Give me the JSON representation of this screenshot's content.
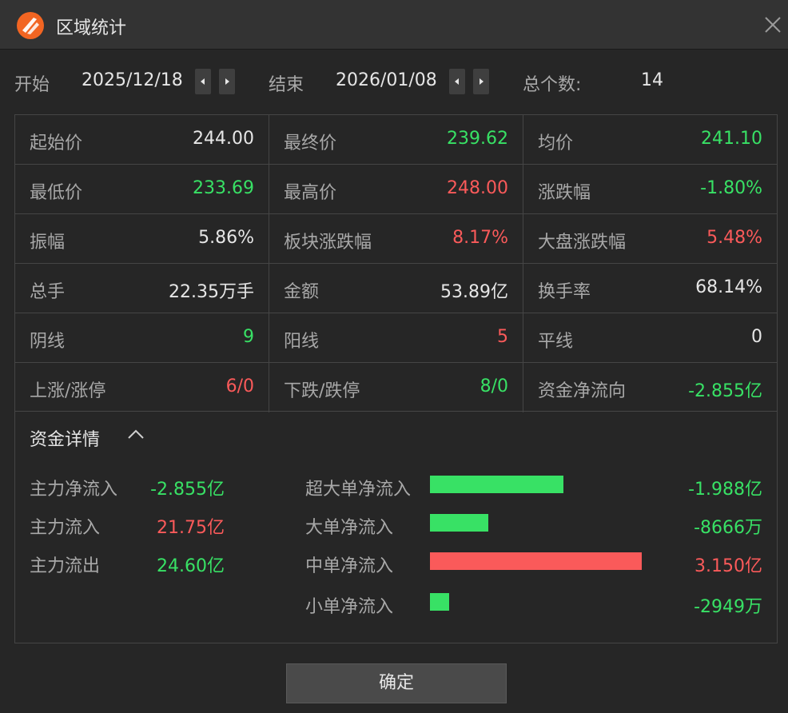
{
  "window": {
    "title": "区域统计"
  },
  "range": {
    "start_label": "开始",
    "start_value": "2025/12/18",
    "end_label": "结束",
    "end_value": "2026/01/08",
    "count_label": "总个数:",
    "count_value": "14"
  },
  "stats": [
    [
      {
        "k": "起始价",
        "v": "244.00",
        "c": "white"
      },
      {
        "k": "最终价",
        "v": "239.62",
        "c": "green"
      },
      {
        "k": "均价",
        "v": "241.10",
        "c": "green"
      }
    ],
    [
      {
        "k": "最低价",
        "v": "233.69",
        "c": "green"
      },
      {
        "k": "最高价",
        "v": "248.00",
        "c": "red"
      },
      {
        "k": "涨跌幅",
        "v": "-1.80%",
        "c": "green"
      }
    ],
    [
      {
        "k": "振幅",
        "v": "5.86%",
        "c": "white"
      },
      {
        "k": "板块涨跌幅",
        "v": "8.17%",
        "c": "red"
      },
      {
        "k": "大盘涨跌幅",
        "v": "5.48%",
        "c": "red"
      }
    ],
    [
      {
        "k": "总手",
        "v": "22.35万手",
        "c": "white"
      },
      {
        "k": "金额",
        "v": "53.89亿",
        "c": "white"
      },
      {
        "k": "换手率",
        "v": "68.14%",
        "c": "white"
      }
    ],
    [
      {
        "k": "阴线",
        "v": "9",
        "c": "green"
      },
      {
        "k": "阳线",
        "v": "5",
        "c": "red"
      },
      {
        "k": "平线",
        "v": "0",
        "c": "white"
      }
    ],
    [
      {
        "k": "上涨/涨停",
        "v": "6/0",
        "c": "red"
      },
      {
        "k": "下跌/跌停",
        "v": "8/0",
        "c": "green"
      },
      {
        "k": "资金净流向",
        "v": "-2.855亿",
        "c": "green"
      }
    ]
  ],
  "fund": {
    "title": "资金详情",
    "main": [
      {
        "k": "主力净流入",
        "v": "-2.855亿",
        "c": "green"
      },
      {
        "k": "主力流入",
        "v": "21.75亿",
        "c": "red"
      },
      {
        "k": "主力流出",
        "v": "24.60亿",
        "c": "green"
      }
    ],
    "orders": [
      {
        "k": "超大单净流入",
        "v": "-1.988亿",
        "c": "green",
        "bar_fraction": 0.63
      },
      {
        "k": "大单净流入",
        "v": "-8666万",
        "c": "green",
        "bar_fraction": 0.275
      },
      {
        "k": "中单净流入",
        "v": "3.150亿",
        "c": "red",
        "bar_fraction": 1.0
      },
      {
        "k": "小单净流入",
        "v": "-2949万",
        "c": "green",
        "bar_fraction": 0.09
      }
    ]
  },
  "colors": {
    "green": "#38e165",
    "red": "#fa5a5a"
  },
  "ok_label": "确定"
}
